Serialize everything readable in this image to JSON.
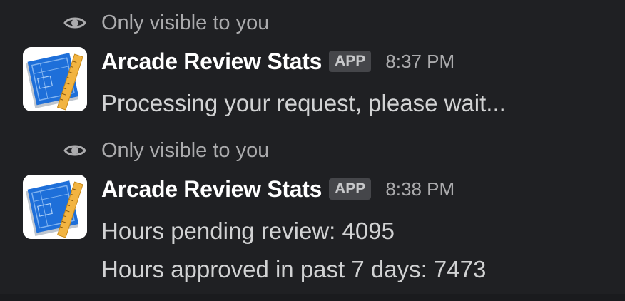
{
  "messages": [
    {
      "ephemeral_label": "Only visible to you",
      "app_name": "Arcade Review Stats",
      "badge": "APP",
      "time": "8:37 PM",
      "lines": [
        "Processing your request, please wait..."
      ]
    },
    {
      "ephemeral_label": "Only visible to you",
      "app_name": "Arcade Review Stats",
      "badge": "APP",
      "time": "8:38 PM",
      "lines": [
        "Hours pending review: 4095",
        "Hours approved in past 7 days: 7473"
      ]
    }
  ],
  "icons": {
    "ephemeral": "eye-icon",
    "avatar": "blueprint-ruler-icon"
  },
  "colors": {
    "background": "#1f2023",
    "text_primary": "#ffffff",
    "text_secondary": "#ababad",
    "text_body": "#d1d2d3",
    "badge_bg": "#45464a",
    "avatar_blue": "#1e6fd9",
    "avatar_ruler": "#f2b441"
  }
}
